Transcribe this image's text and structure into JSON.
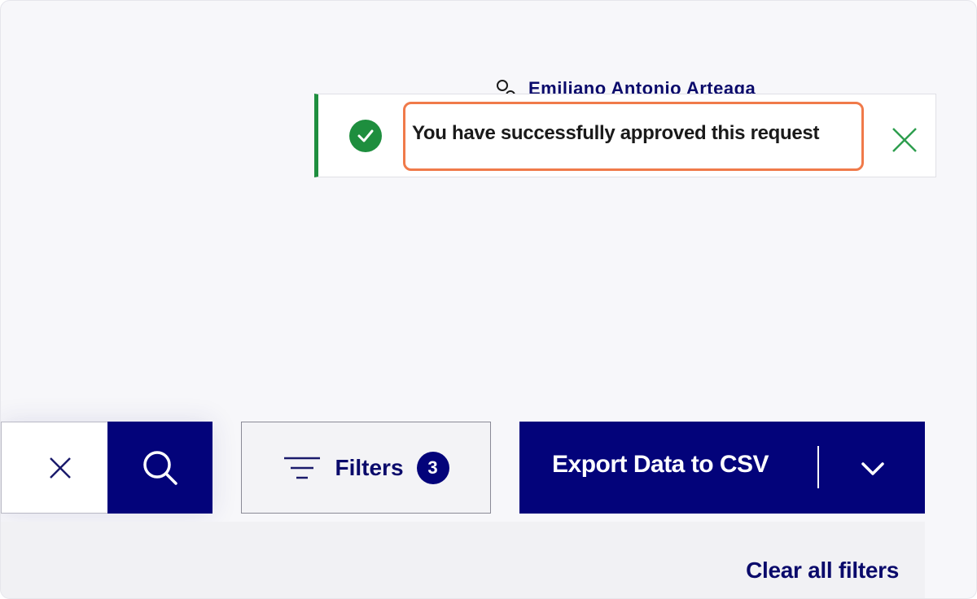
{
  "header": {
    "user_name": "Emiliano Antonio Arteaga"
  },
  "toast": {
    "message": "You have successfully approved this request",
    "status": "success",
    "accent_color": "#1e8e3e"
  },
  "search": {
    "value": "",
    "placeholder": ""
  },
  "toolbar": {
    "filters_label": "Filters",
    "filters_count": "3",
    "export_label": "Export Data to CSV",
    "clear_filters_label": "Clear all filters"
  },
  "colors": {
    "primary": "#03037a",
    "highlight": "#f07a4a"
  },
  "icons": {
    "toast_status": "check-circle-icon",
    "toast_close": "close-icon",
    "search_clear": "clear-icon",
    "search_submit": "search-icon",
    "filters": "filter-icon",
    "export_menu": "chevron-down-icon",
    "user": "person-icon"
  }
}
